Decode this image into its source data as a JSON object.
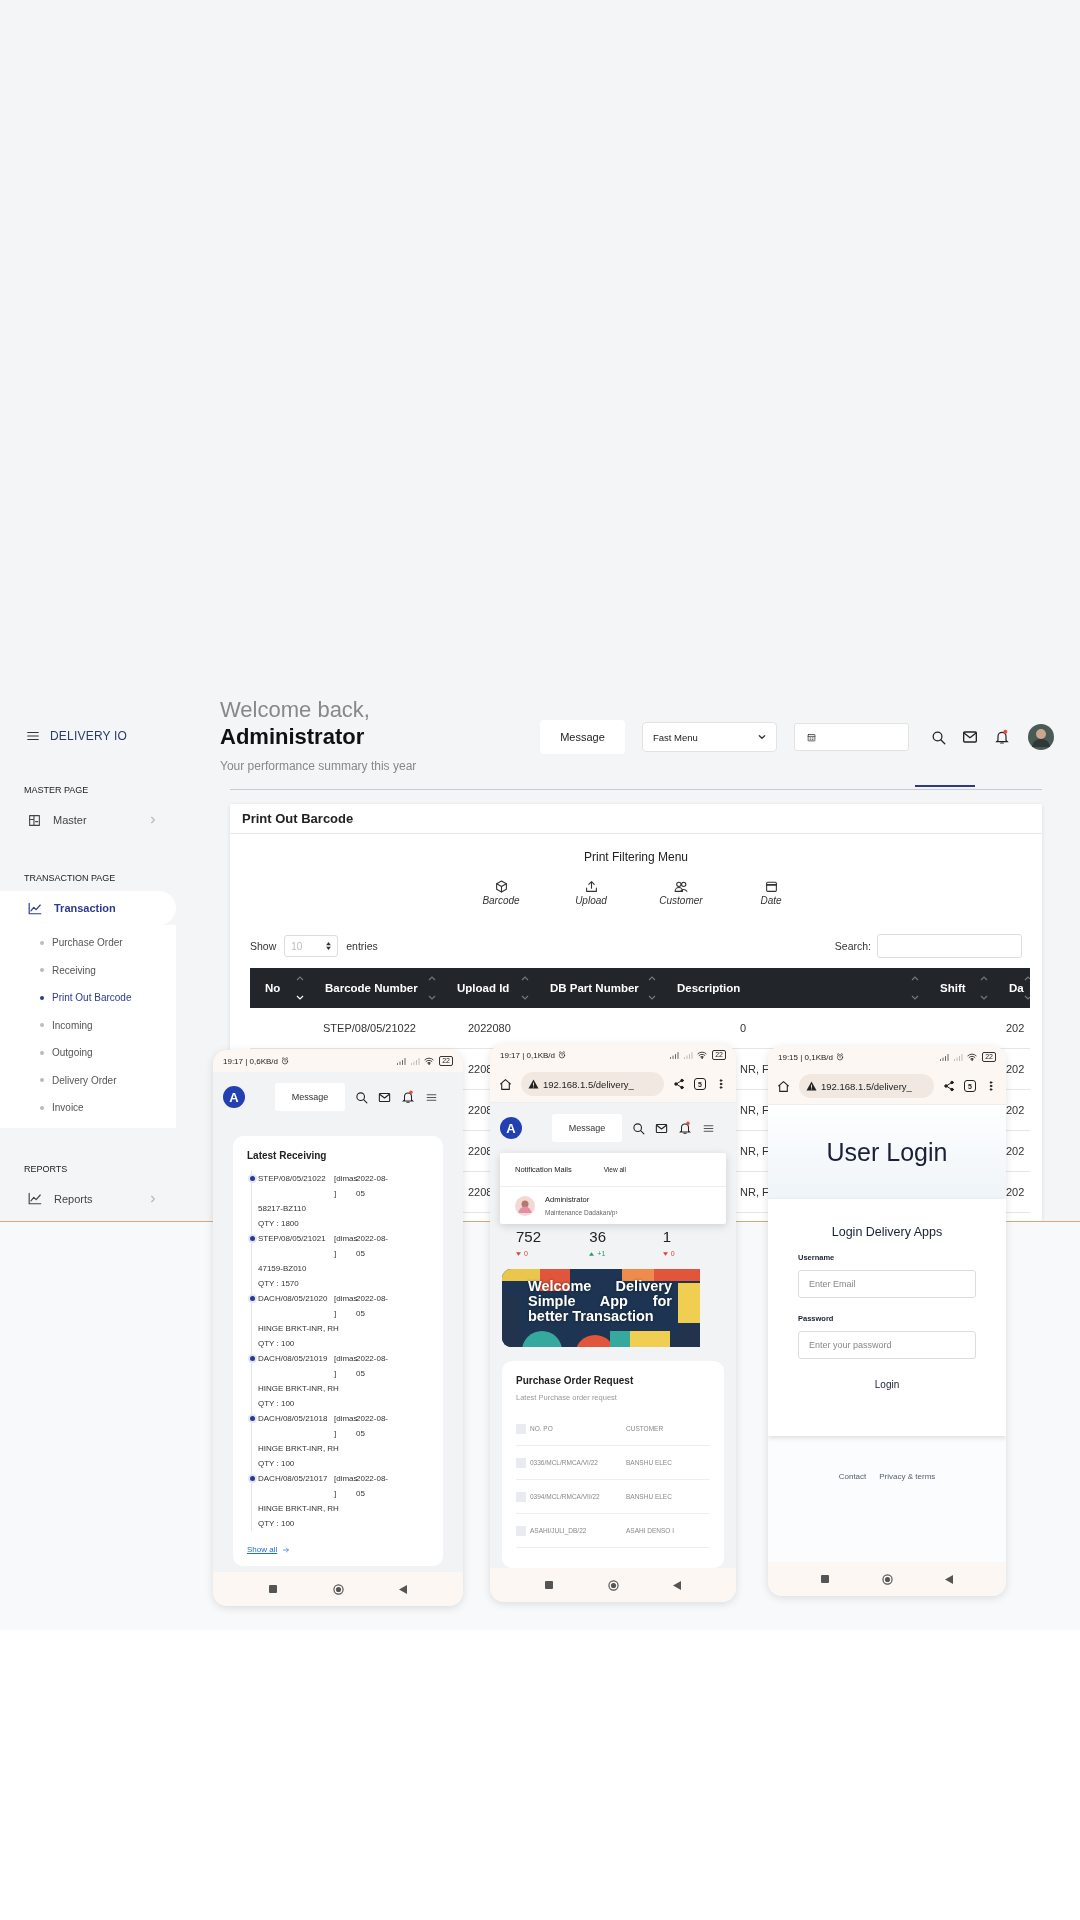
{
  "sidebar": {
    "brand": "DELIVERY IO",
    "sections": [
      {
        "heading": "MASTER PAGE",
        "items": [
          {
            "label": "Master",
            "selected": false
          }
        ]
      },
      {
        "heading": "TRANSACTION PAGE",
        "items": [
          {
            "label": "Transaction",
            "selected": true,
            "children": [
              {
                "label": "Purchase Order",
                "selected": false
              },
              {
                "label": "Receiving",
                "selected": false
              },
              {
                "label": "Print Out Barcode",
                "selected": true
              },
              {
                "label": "Incoming",
                "selected": false
              },
              {
                "label": "Outgoing",
                "selected": false
              },
              {
                "label": "Delivery Order",
                "selected": false
              },
              {
                "label": "Invoice",
                "selected": false
              }
            ]
          }
        ]
      },
      {
        "heading": "REPORTS",
        "items": [
          {
            "label": "Reports",
            "selected": false
          }
        ]
      }
    ]
  },
  "header": {
    "greeting": "Welcome back,",
    "name": "Administrator",
    "subtitle": "Your performance summary this year",
    "message_button": "Message",
    "fast_menu": "Fast Menu",
    "has_notification": true
  },
  "card": {
    "title": "Print Out Barcode",
    "filter_title": "Print Filtering Menu",
    "filters": [
      {
        "label": "Barcode"
      },
      {
        "label": "Upload"
      },
      {
        "label": "Customer"
      },
      {
        "label": "Date"
      }
    ],
    "show_label": "Show",
    "page_size": "10",
    "entries_label": "entries",
    "search_label": "Search:",
    "table": {
      "columns": [
        {
          "label": "No",
          "sorted": true
        },
        {
          "label": "Barcode Number",
          "sorted": false
        },
        {
          "label": "Upload Id",
          "sorted": false
        },
        {
          "label": "DB Part Number",
          "sorted": false
        },
        {
          "label": "Description",
          "sorted": false
        },
        {
          "label": "Shift",
          "sorted": false
        },
        {
          "label": "Da",
          "sorted": false
        }
      ],
      "rows": [
        {
          "barcode_number": "STEP/08/05/21022",
          "upload_id": "2022080",
          "description": "0",
          "column_7": "202"
        },
        {
          "upload_id": "2208",
          "description": "NR, F",
          "column_7": "202"
        },
        {
          "upload_id": "2208",
          "description": "NR, F",
          "column_7": "202"
        },
        {
          "upload_id": "2208",
          "description": "NR, F",
          "column_7": "202"
        },
        {
          "upload_id": "2208",
          "description": "NR, F",
          "column_7": "202"
        }
      ]
    }
  },
  "phones": [
    {
      "kind": "receiving",
      "status": {
        "time": "19:17 | 0,6KB/d",
        "battery": "22"
      },
      "app_bar": {
        "logo": "A",
        "message_button": "Message",
        "has_notification": true
      },
      "title": "Latest Receiving",
      "items": [
        {
          "code": "STEP/08/05/21022",
          "user": "[dimas ]",
          "date": "2022-08-05",
          "part": "58217-BZ110",
          "qty": "QTY : 1800"
        },
        {
          "code": "STEP/08/05/21021",
          "user": "[dimas ]",
          "date": "2022-08-05",
          "part": "47159-BZ010",
          "qty": "QTY : 1570"
        },
        {
          "code": "DACH/08/05/21020",
          "user": "[dimas ]",
          "date": "2022-08-05",
          "part": "HINGE BRKT-INR, RH",
          "qty": "QTY : 100"
        },
        {
          "code": "DACH/08/05/21019",
          "user": "[dimas ]",
          "date": "2022-08-05",
          "part": "HINGE BRKT-INR, RH",
          "qty": "QTY : 100"
        },
        {
          "code": "DACH/08/05/21018",
          "user": "[dimas ]",
          "date": "2022-08-05",
          "part": "HINGE BRKT-INR, RH",
          "qty": "QTY : 100"
        },
        {
          "code": "DACH/08/05/21017",
          "user": "[dimas ]",
          "date": "2022-08-05",
          "part": "HINGE BRKT-INR, RH",
          "qty": "QTY : 100"
        }
      ],
      "show_all": "Show all"
    },
    {
      "kind": "dashboard",
      "status": {
        "time": "19:17 | 0,1KB/d",
        "battery": "22"
      },
      "browser": {
        "url": "192.168.1.5/delivery_",
        "tabs": "5"
      },
      "app_bar": {
        "logo": "A",
        "message_button": "Message",
        "has_notification": true
      },
      "notifications": {
        "title": "Notification Mails",
        "view_all": "View all",
        "items": [
          {
            "sender": "Administrator",
            "preview": "Maintenance Dadakan/p›"
          }
        ]
      },
      "stats": [
        {
          "value": "752",
          "delta": "0",
          "rising": false
        },
        {
          "value": "36",
          "delta": "+1",
          "rising": true
        },
        {
          "value": "1",
          "delta": "0",
          "rising": false
        }
      ],
      "banner": {
        "text": "Welcome Delivery Simple App for better Transaction"
      },
      "po_card": {
        "title": "Purchase Order Request",
        "subtitle": "Latest Purchase order request",
        "columns": [
          "NO. PO",
          "CUSTOMER"
        ],
        "select_all_checked": false,
        "rows": [
          {
            "checked": false,
            "cells": [
              "0336/MCL/RMCA/VI/22",
              "BANSHU ELEC"
            ]
          },
          {
            "checked": false,
            "cells": [
              "0394/MCL/RMCA/VII/22",
              "BANSHU ELEC"
            ]
          },
          {
            "checked": false,
            "cells": [
              "ASAHI/JULI_DB/22",
              "ASAHI DENSO I"
            ]
          }
        ]
      }
    },
    {
      "kind": "login",
      "status": {
        "time": "19:15 | 0,1KB/d",
        "battery": "22"
      },
      "browser": {
        "url": "192.168.1.5/delivery_",
        "tabs": "5"
      },
      "title": "User Login",
      "form": {
        "heading": "Login Delivery Apps",
        "fields": [
          {
            "label": "Username",
            "placeholder": "Enter Email"
          },
          {
            "label": "Password",
            "placeholder": "Enter your password"
          }
        ],
        "submit": "Login"
      },
      "footer_links": [
        "Contact",
        "Privacy & terms"
      ]
    }
  ]
}
